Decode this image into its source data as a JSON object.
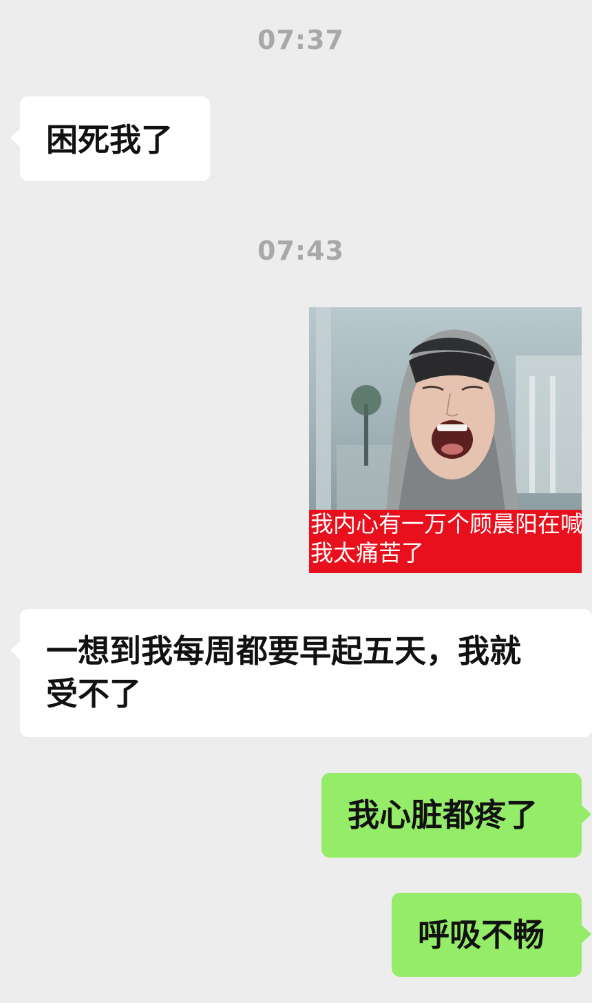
{
  "messages": [
    {
      "type": "timestamp",
      "text": "07:37"
    },
    {
      "type": "incoming",
      "text": "困死我了"
    },
    {
      "type": "timestamp",
      "text": "07:43"
    },
    {
      "type": "outgoing_image",
      "caption_line1": "我内心有一万个顾晨阳在喊",
      "caption_line2": "我太痛苦了"
    },
    {
      "type": "incoming",
      "text_line1": "一想到我每周都要早起五天，我就",
      "text_line2": "受不了"
    },
    {
      "type": "outgoing",
      "text": "我心脏都疼了"
    },
    {
      "type": "outgoing",
      "text": "呼吸不畅"
    }
  ],
  "colors": {
    "background": "#ededed",
    "incoming_bubble": "#ffffff",
    "outgoing_bubble": "#95ec69",
    "timestamp_text": "#a8a8a8",
    "caption_bg": "#e8101c"
  }
}
